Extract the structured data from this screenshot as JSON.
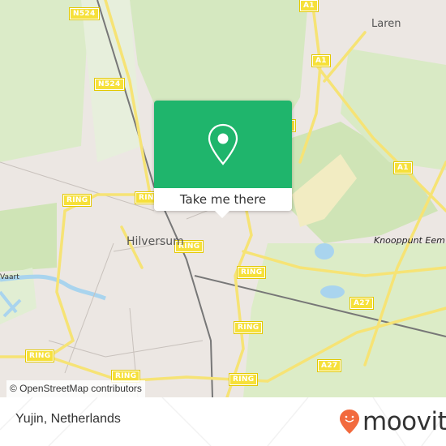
{
  "map": {
    "place_labels": {
      "hilversum": "Hilversum",
      "laren": "Laren",
      "knooppunt": "Knooppunt Eem",
      "vaart": "Vaart"
    },
    "road_shields": {
      "n524_top": "N524",
      "n524_mid": "N524",
      "a1_top": "A1",
      "a1_mid": "A1",
      "a1_right": "A1",
      "a27_top": "A27",
      "a27_bottom": "A27",
      "ring_1": "RING",
      "ring_2": "RING",
      "ring_3": "RING",
      "ring_4": "RING",
      "ring_5": "RING",
      "ring_6": "RING",
      "ring_7": "RING",
      "ring_8": "RING"
    },
    "attribution": "© OpenStreetMap contributors"
  },
  "popup": {
    "button_label": "Take me there",
    "icon": "map-pin-icon",
    "color": "#1fb56c"
  },
  "footer": {
    "location": "Yujin, Netherlands",
    "brand": "moovit",
    "brand_color": "#f26a3e"
  }
}
